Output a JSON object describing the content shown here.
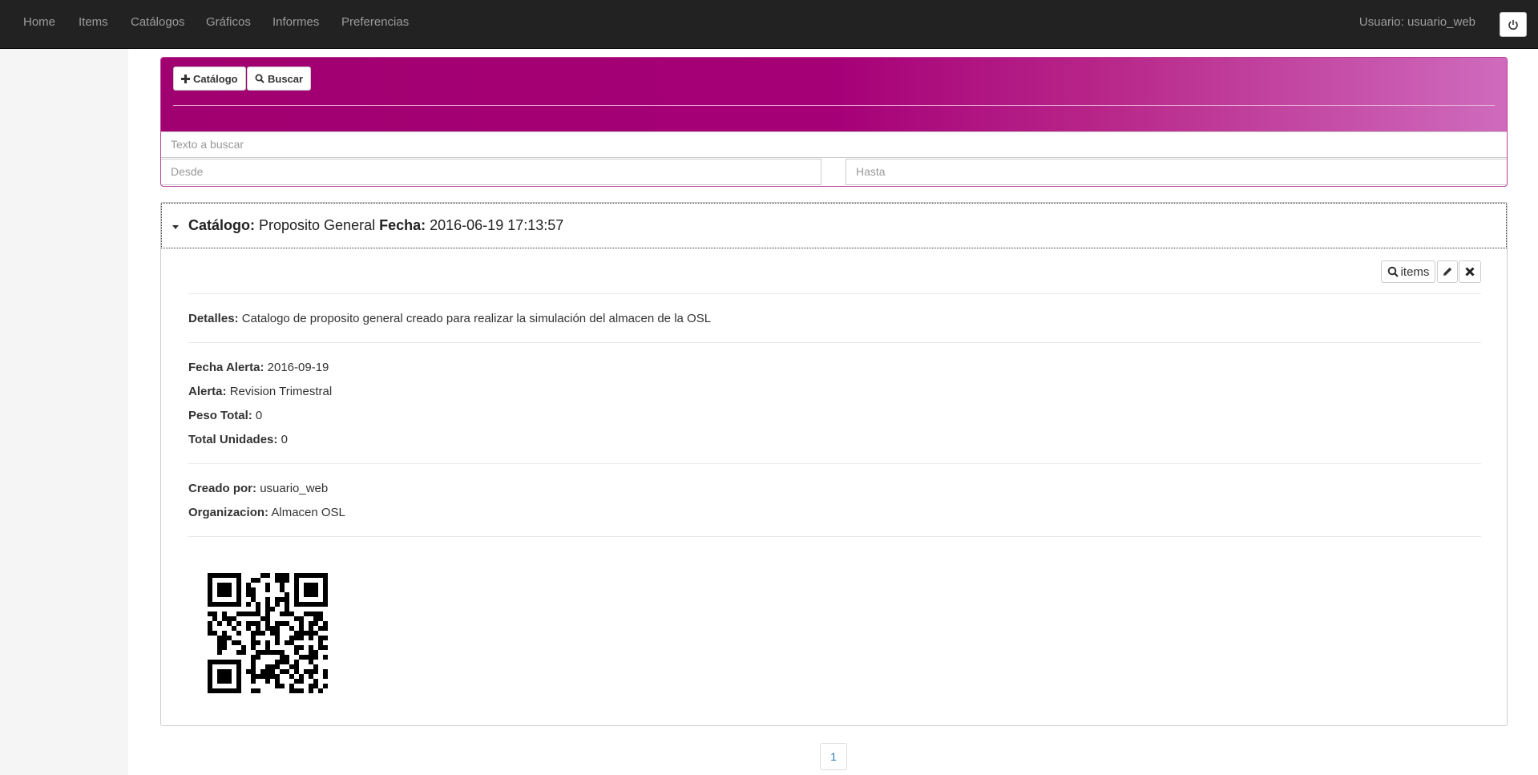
{
  "nav": {
    "items": [
      "Home",
      "Items",
      "Catálogos",
      "Gráficos",
      "Informes",
      "Preferencias"
    ],
    "user": "Usuario: usuario_web"
  },
  "search": {
    "add_label": "Catálogo",
    "search_label": "Buscar",
    "text_placeholder": "Texto a buscar",
    "from_placeholder": "Desde",
    "to_placeholder": "Hasta"
  },
  "catalog": {
    "catalog_label": "Catálogo:",
    "catalog_name": "Proposito General",
    "date_label": "Fecha:",
    "date_value": "2016-06-19 17:13:57",
    "items_button": "items",
    "details_label": "Detalles:",
    "details_value": "Catalogo de proposito general creado para realizar la simulación del almacen de la OSL",
    "alert_date_label": "Fecha Alerta:",
    "alert_date_value": "2016-09-19",
    "alert_label": "Alerta:",
    "alert_value": "Revision Trimestral",
    "weight_label": "Peso Total:",
    "weight_value": "0",
    "units_label": "Total Unidades:",
    "units_value": "0",
    "created_by_label": "Creado por:",
    "created_by_value": "usuario_web",
    "org_label": "Organizacion:",
    "org_value": "Almacen OSL",
    "qr_icon": "qr-code"
  },
  "pagination": {
    "current": "1"
  },
  "colors": {
    "panel_magenta": "#a60077",
    "navbar": "#222222"
  }
}
